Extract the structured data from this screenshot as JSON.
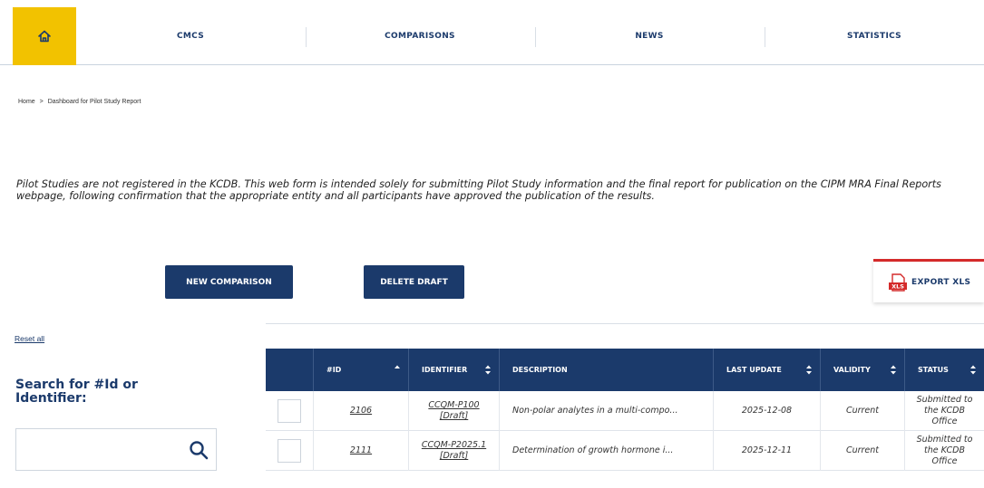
{
  "nav": {
    "items": [
      "CMCS",
      "COMPARISONS",
      "NEWS",
      "STATISTICS"
    ],
    "accent": "#f2c200",
    "brand": "#1b3a6b"
  },
  "breadcrumb": {
    "home": "Home",
    "separator": ">",
    "current": "Dashboard for Pilot Study Report"
  },
  "notice": "Pilot Studies are not registered in the KCDB. This web form is intended solely for submitting Pilot Study information and the final report for publication on the CIPM MRA Final Reports webpage, following confirmation that the appropriate entity and all participants have approved the publication of the results.",
  "actions": {
    "new_comparison": "NEW COMPARISON",
    "delete_draft": "DELETE DRAFT",
    "export_xls": "EXPORT XLS",
    "export_icon_text": "XLS"
  },
  "filters": {
    "reset_all": "Reset all",
    "search_label": "Search for #Id or Identifier:",
    "search_value": "",
    "search_placeholder": ""
  },
  "table": {
    "columns": [
      "#ID",
      "IDENTIFIER",
      "DESCRIPTION",
      "LAST UPDATE",
      "VALIDITY",
      "STATUS"
    ],
    "rows": [
      {
        "id": "2106",
        "identifier_1": "CCQM-P100",
        "identifier_2": "[Draft]",
        "description": "Non-polar analytes in a multi-compo...",
        "last_update": "2025-12-08",
        "validity": "Current",
        "status_1": "Submitted to",
        "status_2": "the KCDB",
        "status_3": "Office"
      },
      {
        "id": "2111",
        "identifier_1": "CCQM-P2025.1",
        "identifier_2": "[Draft]",
        "description": "Determination of growth hormone i...",
        "last_update": "2025-12-11",
        "validity": "Current",
        "status_1": "Submitted to",
        "status_2": "the KCDB",
        "status_3": "Office"
      }
    ]
  }
}
